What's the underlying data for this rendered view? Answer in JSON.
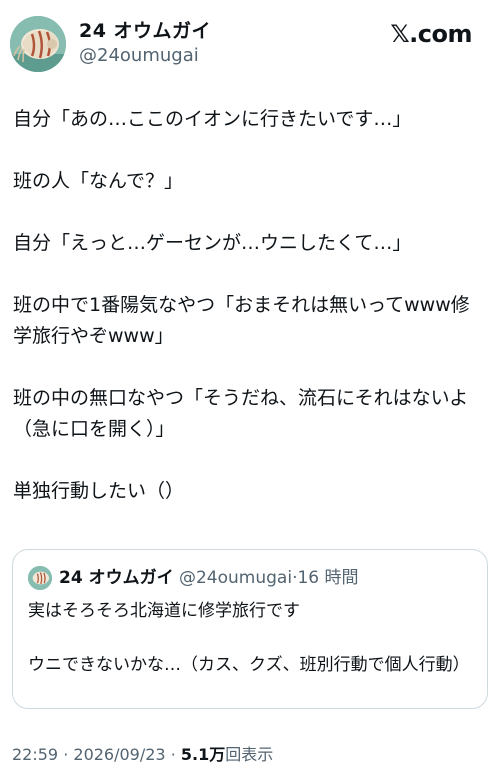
{
  "author": {
    "display_name": "24 オウムガイ",
    "handle": "@24oumugai",
    "avatar_icon": "nautilus-avatar-icon"
  },
  "brand": {
    "logo_text": "𝕏.com"
  },
  "tweet": {
    "text": "自分「あの…ここのイオンに行きたいです…」\n\n班の人「なんで？」\n\n自分「えっと…ゲーセンが…ウニしたくて…」\n\n班の中で1番陽気なやつ「おまそれは無いってwww修学旅行やぞwww」\n\n班の中の無口なやつ「そうだね、流石にそれはないよ（急に口を開く）」\n\n単独行動したい（）"
  },
  "quote": {
    "display_name": "24 オウムガイ",
    "handle": "@24oumugai",
    "separator": "·",
    "time": "16 時間",
    "text": "実はそろそろ北海道に修学旅行です\n\nウニできないかな…（カス、クズ、班別行動で個人行動）"
  },
  "footer": {
    "time": "22:59",
    "separator1": "·",
    "date": "2026/09/23",
    "separator2": "·",
    "views_count": "5.1万",
    "views_label": "回表示"
  },
  "colors": {
    "text": "#0f1419",
    "secondary": "#536471",
    "border": "#cfd9de"
  }
}
